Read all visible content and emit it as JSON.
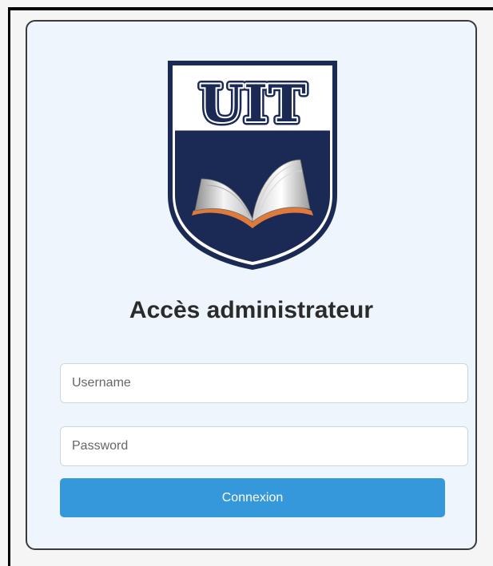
{
  "logo": {
    "text": "UIT"
  },
  "login": {
    "title": "Accès administrateur",
    "username_placeholder": "Username",
    "password_placeholder": "Password",
    "submit_label": "Connexion"
  },
  "colors": {
    "card_background": "#eef5fc",
    "button": "#3498db",
    "shield_navy": "#1b2a55"
  }
}
